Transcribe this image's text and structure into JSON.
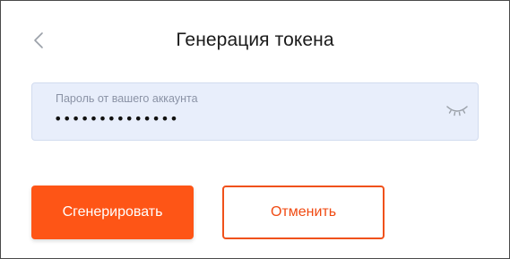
{
  "header": {
    "back_icon": "chevron-left-icon",
    "title": "Генерация токена"
  },
  "password_field": {
    "label": "Пароль от вашего аккаунта",
    "value": "••••••••••••••",
    "toggle_icon": "eye-closed-icon"
  },
  "actions": {
    "generate_label": "Сгенерировать",
    "cancel_label": "Отменить"
  },
  "colors": {
    "accent": "#fe5516",
    "field_bg": "#e8eefb",
    "label_text": "#8b93a6"
  }
}
